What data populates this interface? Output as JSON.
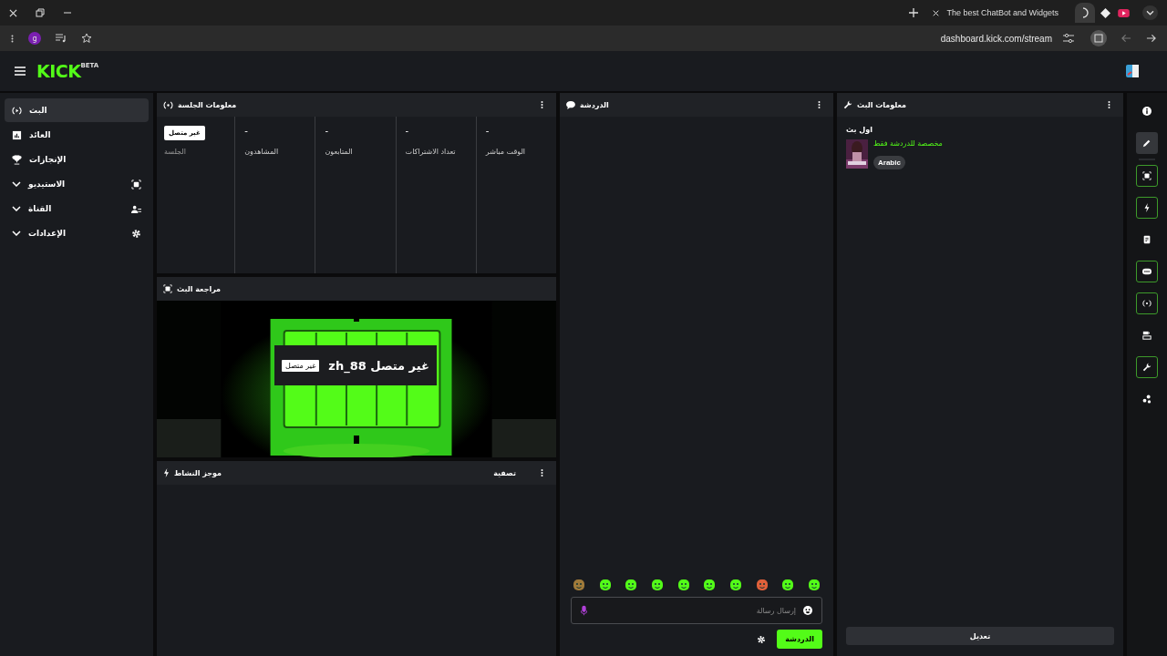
{
  "browser": {
    "tabs": [
      {
        "kind": "page",
        "title": "The best ChatBot and Widgets",
        "selected": false
      },
      {
        "kind": "loading",
        "selected": true
      }
    ],
    "profile_initial": "g",
    "address": "dashboard.kick.com/stream"
  },
  "header": {
    "logo": "KICK",
    "logo_badge": "BETA"
  },
  "sidebar": {
    "items": [
      {
        "label": "البث",
        "kind": "link",
        "selected": true
      },
      {
        "label": "العائد",
        "kind": "link",
        "selected": false
      },
      {
        "label": "الإنجازات",
        "kind": "link",
        "selected": false
      },
      {
        "label": "الاستيديو",
        "kind": "group",
        "selected": false
      },
      {
        "label": "القناة",
        "kind": "group",
        "selected": false
      },
      {
        "label": "الإعدادات",
        "kind": "group",
        "selected": false
      }
    ]
  },
  "session_info": {
    "title": "معلومات الجلسة",
    "stats": [
      {
        "value": "-",
        "label": "الوقت مباشر"
      },
      {
        "value": "-",
        "label": "تعداد الاشتراكات"
      },
      {
        "value": "-",
        "label": "المتابعون"
      },
      {
        "value": "-",
        "label": "المشاهدون"
      },
      {
        "badge": "غير متصل",
        "label": "الجلسة"
      }
    ]
  },
  "stream_preview": {
    "title": "مراجعة البث",
    "overlay_title": "غير متصل zh_88",
    "overlay_badge": "غير متصل"
  },
  "activity_feed": {
    "title": "موجز النشاط",
    "filter": "تصفية"
  },
  "chat": {
    "title": "الدردشة",
    "placeholder": "إرسال رسالة",
    "send_button": "الدردشة"
  },
  "stream_info": {
    "title": "معلومات البث",
    "stream_title": "اول بث",
    "category": "مخصصة للدردشة فقط",
    "tags": [
      "Arabic"
    ],
    "edit_button": "تعديل"
  },
  "right_rail": {
    "items": [
      {
        "on": false,
        "selected": false
      },
      {
        "on": false,
        "selected": true
      },
      {
        "on": true,
        "selected": false
      },
      {
        "on": true,
        "selected": false
      },
      {
        "on": false,
        "selected": false
      },
      {
        "on": true,
        "selected": false
      },
      {
        "on": true,
        "selected": false
      },
      {
        "on": false,
        "selected": false
      },
      {
        "on": true,
        "selected": false
      },
      {
        "on": false,
        "selected": false
      }
    ]
  }
}
